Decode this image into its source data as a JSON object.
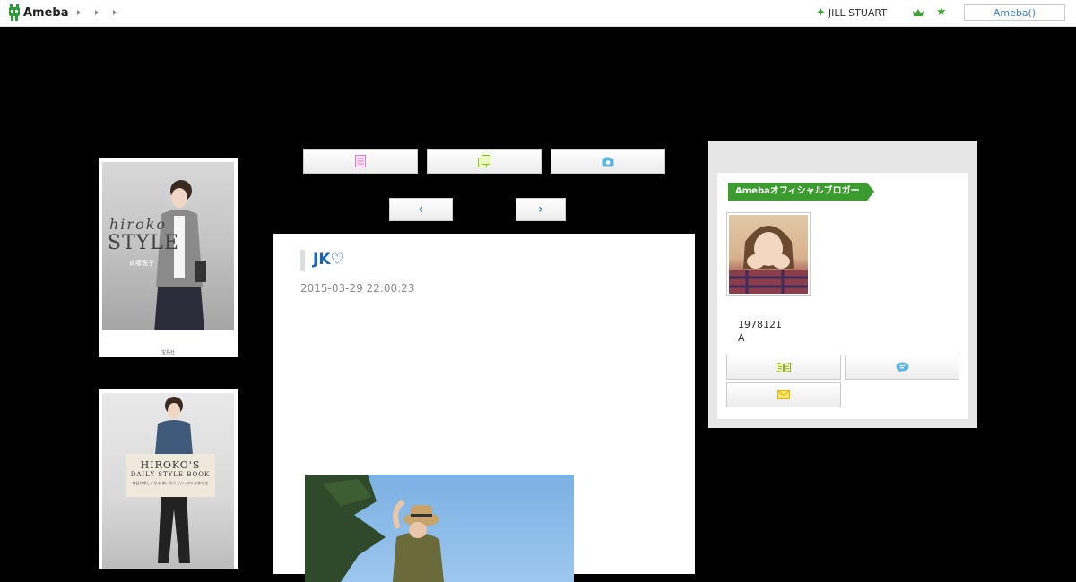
{
  "header": {
    "logo_text": "Ameba",
    "brand_link": "JILL STUART",
    "ameba_button": "Ameba()"
  },
  "article": {
    "title": "JK♡",
    "date": "2015-03-29 22:00:23"
  },
  "books": [
    {
      "title_script": "hiroko",
      "title_main": "STYLE",
      "author": "斉藤寛子",
      "publisher": "宝島社"
    },
    {
      "title_main": "HIROKO'S",
      "title_sub": "DAILY STYLE BOOK",
      "tagline": "毎日が楽しくなる 新・大人カジュアルの作り方"
    }
  ],
  "sidebar": {
    "badge": "Amebaオフィシャルブロガー",
    "birth": "1978121",
    "blood": "A"
  },
  "colors": {
    "accent_green": "#3c9b2e",
    "link_blue": "#1a63b5"
  }
}
